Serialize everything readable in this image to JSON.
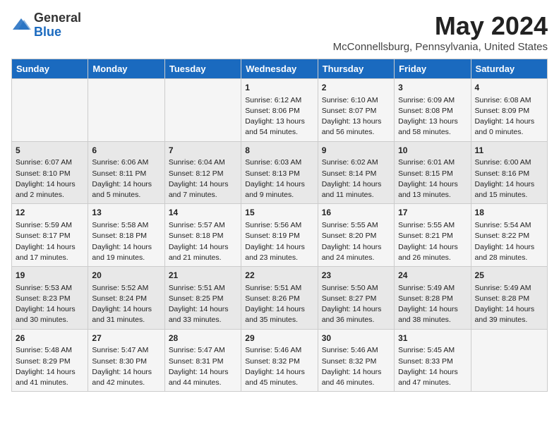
{
  "logo": {
    "general": "General",
    "blue": "Blue"
  },
  "title": "May 2024",
  "subtitle": "McConnellsburg, Pennsylvania, United States",
  "calendar": {
    "headers": [
      "Sunday",
      "Monday",
      "Tuesday",
      "Wednesday",
      "Thursday",
      "Friday",
      "Saturday"
    ],
    "rows": [
      [
        {
          "day": "",
          "info": ""
        },
        {
          "day": "",
          "info": ""
        },
        {
          "day": "",
          "info": ""
        },
        {
          "day": "1",
          "info": "Sunrise: 6:12 AM\nSunset: 8:06 PM\nDaylight: 13 hours\nand 54 minutes."
        },
        {
          "day": "2",
          "info": "Sunrise: 6:10 AM\nSunset: 8:07 PM\nDaylight: 13 hours\nand 56 minutes."
        },
        {
          "day": "3",
          "info": "Sunrise: 6:09 AM\nSunset: 8:08 PM\nDaylight: 13 hours\nand 58 minutes."
        },
        {
          "day": "4",
          "info": "Sunrise: 6:08 AM\nSunset: 8:09 PM\nDaylight: 14 hours\nand 0 minutes."
        }
      ],
      [
        {
          "day": "5",
          "info": "Sunrise: 6:07 AM\nSunset: 8:10 PM\nDaylight: 14 hours\nand 2 minutes."
        },
        {
          "day": "6",
          "info": "Sunrise: 6:06 AM\nSunset: 8:11 PM\nDaylight: 14 hours\nand 5 minutes."
        },
        {
          "day": "7",
          "info": "Sunrise: 6:04 AM\nSunset: 8:12 PM\nDaylight: 14 hours\nand 7 minutes."
        },
        {
          "day": "8",
          "info": "Sunrise: 6:03 AM\nSunset: 8:13 PM\nDaylight: 14 hours\nand 9 minutes."
        },
        {
          "day": "9",
          "info": "Sunrise: 6:02 AM\nSunset: 8:14 PM\nDaylight: 14 hours\nand 11 minutes."
        },
        {
          "day": "10",
          "info": "Sunrise: 6:01 AM\nSunset: 8:15 PM\nDaylight: 14 hours\nand 13 minutes."
        },
        {
          "day": "11",
          "info": "Sunrise: 6:00 AM\nSunset: 8:16 PM\nDaylight: 14 hours\nand 15 minutes."
        }
      ],
      [
        {
          "day": "12",
          "info": "Sunrise: 5:59 AM\nSunset: 8:17 PM\nDaylight: 14 hours\nand 17 minutes."
        },
        {
          "day": "13",
          "info": "Sunrise: 5:58 AM\nSunset: 8:18 PM\nDaylight: 14 hours\nand 19 minutes."
        },
        {
          "day": "14",
          "info": "Sunrise: 5:57 AM\nSunset: 8:18 PM\nDaylight: 14 hours\nand 21 minutes."
        },
        {
          "day": "15",
          "info": "Sunrise: 5:56 AM\nSunset: 8:19 PM\nDaylight: 14 hours\nand 23 minutes."
        },
        {
          "day": "16",
          "info": "Sunrise: 5:55 AM\nSunset: 8:20 PM\nDaylight: 14 hours\nand 24 minutes."
        },
        {
          "day": "17",
          "info": "Sunrise: 5:55 AM\nSunset: 8:21 PM\nDaylight: 14 hours\nand 26 minutes."
        },
        {
          "day": "18",
          "info": "Sunrise: 5:54 AM\nSunset: 8:22 PM\nDaylight: 14 hours\nand 28 minutes."
        }
      ],
      [
        {
          "day": "19",
          "info": "Sunrise: 5:53 AM\nSunset: 8:23 PM\nDaylight: 14 hours\nand 30 minutes."
        },
        {
          "day": "20",
          "info": "Sunrise: 5:52 AM\nSunset: 8:24 PM\nDaylight: 14 hours\nand 31 minutes."
        },
        {
          "day": "21",
          "info": "Sunrise: 5:51 AM\nSunset: 8:25 PM\nDaylight: 14 hours\nand 33 minutes."
        },
        {
          "day": "22",
          "info": "Sunrise: 5:51 AM\nSunset: 8:26 PM\nDaylight: 14 hours\nand 35 minutes."
        },
        {
          "day": "23",
          "info": "Sunrise: 5:50 AM\nSunset: 8:27 PM\nDaylight: 14 hours\nand 36 minutes."
        },
        {
          "day": "24",
          "info": "Sunrise: 5:49 AM\nSunset: 8:28 PM\nDaylight: 14 hours\nand 38 minutes."
        },
        {
          "day": "25",
          "info": "Sunrise: 5:49 AM\nSunset: 8:28 PM\nDaylight: 14 hours\nand 39 minutes."
        }
      ],
      [
        {
          "day": "26",
          "info": "Sunrise: 5:48 AM\nSunset: 8:29 PM\nDaylight: 14 hours\nand 41 minutes."
        },
        {
          "day": "27",
          "info": "Sunrise: 5:47 AM\nSunset: 8:30 PM\nDaylight: 14 hours\nand 42 minutes."
        },
        {
          "day": "28",
          "info": "Sunrise: 5:47 AM\nSunset: 8:31 PM\nDaylight: 14 hours\nand 44 minutes."
        },
        {
          "day": "29",
          "info": "Sunrise: 5:46 AM\nSunset: 8:32 PM\nDaylight: 14 hours\nand 45 minutes."
        },
        {
          "day": "30",
          "info": "Sunrise: 5:46 AM\nSunset: 8:32 PM\nDaylight: 14 hours\nand 46 minutes."
        },
        {
          "day": "31",
          "info": "Sunrise: 5:45 AM\nSunset: 8:33 PM\nDaylight: 14 hours\nand 47 minutes."
        },
        {
          "day": "",
          "info": ""
        }
      ]
    ]
  }
}
